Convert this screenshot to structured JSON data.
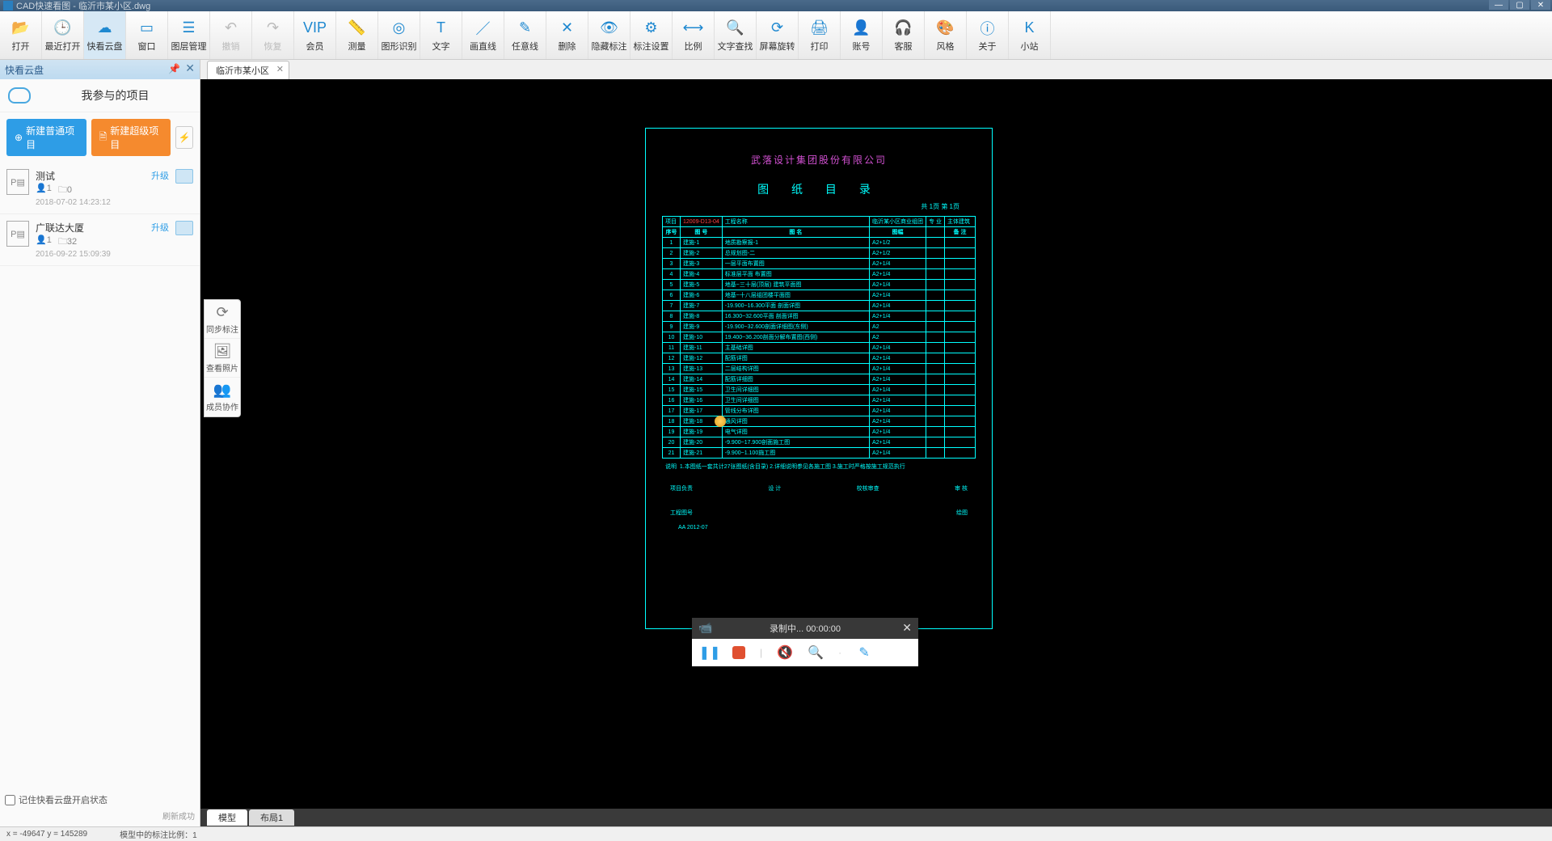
{
  "titlebar": {
    "title": "CAD快速看图 - 临沂市某小区.dwg"
  },
  "toolbar": [
    {
      "id": "open",
      "label": "打开",
      "icon": "📂"
    },
    {
      "id": "recent",
      "label": "最近打开",
      "icon": "🕒"
    },
    {
      "id": "clouddisk",
      "label": "快看云盘",
      "icon": "☁",
      "active": true
    },
    {
      "id": "window",
      "label": "窗口",
      "icon": "▭"
    },
    {
      "id": "layer",
      "label": "图层管理",
      "icon": "☰"
    },
    {
      "id": "undo",
      "label": "撤销",
      "icon": "↶",
      "disabled": true
    },
    {
      "id": "redo",
      "label": "恢复",
      "icon": "↷",
      "disabled": true
    },
    {
      "id": "vip",
      "label": "会员",
      "icon": "VIP"
    },
    {
      "id": "measure",
      "label": "测量",
      "icon": "📏"
    },
    {
      "id": "shaperec",
      "label": "图形识别",
      "icon": "◎"
    },
    {
      "id": "text",
      "label": "文字",
      "icon": "T"
    },
    {
      "id": "line",
      "label": "画直线",
      "icon": "／"
    },
    {
      "id": "freeline",
      "label": "任意线",
      "icon": "✎"
    },
    {
      "id": "delete",
      "label": "删除",
      "icon": "✕"
    },
    {
      "id": "hidemark",
      "label": "隐藏标注",
      "icon": "👁"
    },
    {
      "id": "marksetting",
      "label": "标注设置",
      "icon": "⚙"
    },
    {
      "id": "scale",
      "label": "比例",
      "icon": "⟷"
    },
    {
      "id": "findtext",
      "label": "文字查找",
      "icon": "🔍"
    },
    {
      "id": "rotate",
      "label": "屏幕旋转",
      "icon": "⟳"
    },
    {
      "id": "print",
      "label": "打印",
      "icon": "🖨"
    },
    {
      "id": "account",
      "label": "账号",
      "icon": "👤"
    },
    {
      "id": "service",
      "label": "客服",
      "icon": "🎧"
    },
    {
      "id": "style",
      "label": "风格",
      "icon": "🎨"
    },
    {
      "id": "about",
      "label": "关于",
      "icon": "ⓘ"
    },
    {
      "id": "site",
      "label": "小站",
      "icon": "K"
    }
  ],
  "sidebar": {
    "title": "快看云盘",
    "my_projects": "我参与的项目",
    "new_normal": "新建普通项目",
    "new_super": "新建超级项目",
    "projects": [
      {
        "name": "测试",
        "members": "1",
        "folders": "0",
        "date": "2018-07-02 14:23:12",
        "upgrade": "升级"
      },
      {
        "name": "广联达大厦",
        "members": "1",
        "folders": "32",
        "date": "2016-09-22 15:09:39",
        "upgrade": "升级"
      }
    ],
    "remember": "记住快看云盘开启状态",
    "refresh_ok": "刷新成功"
  },
  "float_tools": [
    {
      "id": "sync",
      "label": "同步标注",
      "icon": "⟳"
    },
    {
      "id": "photo",
      "label": "查看照片",
      "icon": "🖼"
    },
    {
      "id": "collab",
      "label": "成员协作",
      "icon": "👥"
    }
  ],
  "doc_tab": "临沂市某小区",
  "drawing": {
    "company": "武落设计集团股份有限公司",
    "title": "图 纸 目 录",
    "sub": "共 1页 第 1页",
    "meta_row": {
      "c1": "项目",
      "c2": "12009-D13-04",
      "c3": "工程名称",
      "c4": "临沂某小区商业组团",
      "c5": "专 业",
      "c6": "主体建筑"
    },
    "headers": [
      "序号",
      "图 号",
      "图 名",
      "图幅",
      "备 注"
    ],
    "rows": [
      [
        "1",
        "建施-1",
        "地质勘察报-1",
        "A2+1/2",
        ""
      ],
      [
        "2",
        "建施-2",
        "总规划图-二",
        "A2+1/2",
        ""
      ],
      [
        "3",
        "建施-3",
        "一层平面布置图",
        "A2+1/4",
        ""
      ],
      [
        "4",
        "建施-4",
        "标准层平面 布置图",
        "A2+1/4",
        ""
      ],
      [
        "5",
        "建施-5",
        "地基~三十层(顶层) 建筑平面图",
        "A2+1/4",
        ""
      ],
      [
        "6",
        "建施-6",
        "地基~十八层组团楼平面图",
        "A2+1/4",
        ""
      ],
      [
        "7",
        "建施-7",
        "-19.900~16.300平面 剖面详图",
        "A2+1/4",
        ""
      ],
      [
        "8",
        "建施-8",
        "16.300~32.600平面 剖面详图",
        "A2+1/4",
        ""
      ],
      [
        "9",
        "建施-9",
        "-19.900~32.600剖面详细图(东侧)",
        "A2",
        ""
      ],
      [
        "10",
        "建施-10",
        "19.400~36.200剖面分解布置图(西侧)",
        "A2",
        ""
      ],
      [
        "11",
        "建施-11",
        "主基础详图",
        "A2+1/4",
        ""
      ],
      [
        "12",
        "建施-12",
        "配筋详图",
        "A2+1/4",
        ""
      ],
      [
        "13",
        "建施-13",
        "二层结构详图",
        "A2+1/4",
        ""
      ],
      [
        "14",
        "建施-14",
        "配筋详细图",
        "A2+1/4",
        ""
      ],
      [
        "15",
        "建施-15",
        "卫生间详细图",
        "A2+1/4",
        ""
      ],
      [
        "16",
        "建施-16",
        "卫生间详细图",
        "A2+1/4",
        ""
      ],
      [
        "17",
        "建施-17",
        "管线分布详图",
        "A2+1/4",
        ""
      ],
      [
        "18",
        "建施-18",
        "通风详图",
        "A2+1/4",
        ""
      ],
      [
        "19",
        "建施-19",
        "电气详图",
        "A2+1/4",
        ""
      ],
      [
        "20",
        "建施-20",
        "-9.900~17.900剖面施工图",
        "A2+1/4",
        ""
      ],
      [
        "21",
        "建施-21",
        "-9.900~1.100施工图",
        "A2+1/4",
        ""
      ]
    ],
    "notes_label": "说明",
    "notes": "1.本图纸一套共计27张图纸(含目录)\n2.详细说明参见各施工图\n3.施工时严格按施工规范执行",
    "sig": {
      "proj_manager": "项目负责",
      "design": "设 计",
      "check": "校核审查",
      "audit": "审 核"
    },
    "footer": {
      "drawnum": "工程图号",
      "draw": "绘图"
    },
    "code": "AA  2012-07"
  },
  "recorder": {
    "status": "录制中... 00:00:00"
  },
  "bottom_tabs": [
    "模型",
    "布局1"
  ],
  "statusbar": {
    "coords": "x = -49647 y = 145289",
    "scale": "模型中的标注比例：1"
  }
}
